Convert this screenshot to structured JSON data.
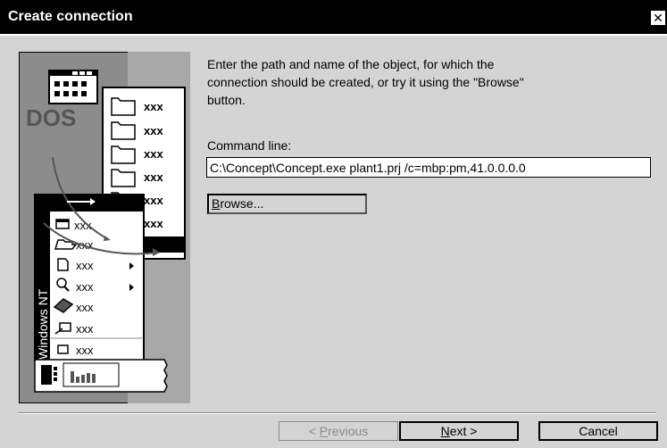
{
  "window": {
    "title": "Create connection",
    "close_glyph": "✕"
  },
  "instructions": "Enter the path and name of the object, for which the connection should be created, or try it using the \"Browse\" button.",
  "command": {
    "label": "Command line:",
    "value": "C:\\Concept\\Concept.exe plant1.prj /c=mbp:pm,41.0.0.0.0"
  },
  "browse_button": {
    "mnemonic": "B",
    "rest": "rowse..."
  },
  "illustration": {
    "dos_label": "DOS",
    "windows_label": "Windows NT",
    "folder_items": [
      "xxx",
      "xxx",
      "xxx",
      "xxx",
      "xxx",
      "xxx"
    ],
    "menu_items": [
      "xxx",
      "xxx",
      "xxx",
      "xxx",
      "xxx",
      "xxx",
      "xxx"
    ]
  },
  "footer": {
    "previous": {
      "prefix": "< ",
      "mnemonic": "P",
      "rest": "revious"
    },
    "next": {
      "mnemonic": "N",
      "rest": "ext >"
    },
    "cancel": "Cancel"
  },
  "colors": {
    "title_bg": "#000000",
    "dialog_bg": "#d4d4d4",
    "illustration_bg": "#8c8c8c"
  }
}
